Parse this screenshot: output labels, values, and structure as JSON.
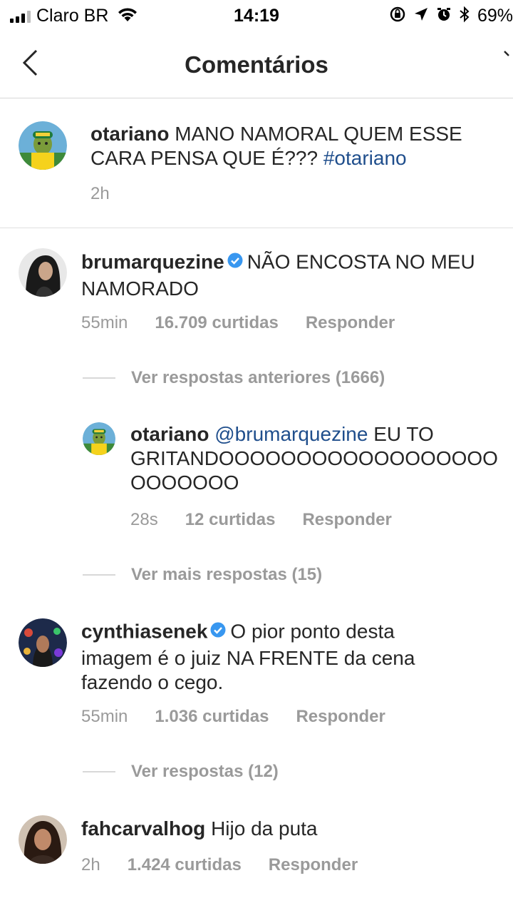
{
  "status_bar": {
    "carrier": "Claro BR",
    "time": "14:19",
    "battery": "69%"
  },
  "nav": {
    "title": "Comentários"
  },
  "caption": {
    "username": "otariano",
    "text": "MANO NAMORAL QUEM ESSE CARA PENSA QUE É???",
    "hashtag": "#otariano",
    "time": "2h"
  },
  "comments": [
    {
      "username": "brumarquezine",
      "verified": true,
      "text": "NÃO ENCOSTA NO MEU NAMORADO",
      "time": "55min",
      "likes": "16.709 curtidas",
      "reply_label": "Responder",
      "previous_replies": "Ver respostas anteriores (1666)",
      "reply": {
        "username": "otariano",
        "mention": "@brumarquezine",
        "text_line1": "EU TO",
        "text_line2": "GRITANDOOOOOOOOOOOOOOOOOO",
        "text_line3": "OOOOOOO",
        "time": "28s",
        "likes": "12 curtidas",
        "reply_label": "Responder"
      },
      "more_replies": "Ver mais respostas (15)"
    },
    {
      "username": "cynthiasenek",
      "verified": true,
      "text_line1": "O pior ponto desta",
      "text_line2": "imagem é o juiz NA FRENTE da cena",
      "text_line3": "fazendo o cego.",
      "time": "55min",
      "likes": "1.036 curtidas",
      "reply_label": "Responder",
      "view_replies": "Ver respostas (12)"
    },
    {
      "username": "fahcarvalhog",
      "verified": false,
      "text": "Hijo da puta",
      "time": "2h",
      "likes": "1.424 curtidas",
      "reply_label": "Responder"
    }
  ],
  "colors": {
    "accent_link": "#1f4e8c",
    "meta_gray": "#9a9a9a",
    "verified_blue": "#3897f0"
  }
}
